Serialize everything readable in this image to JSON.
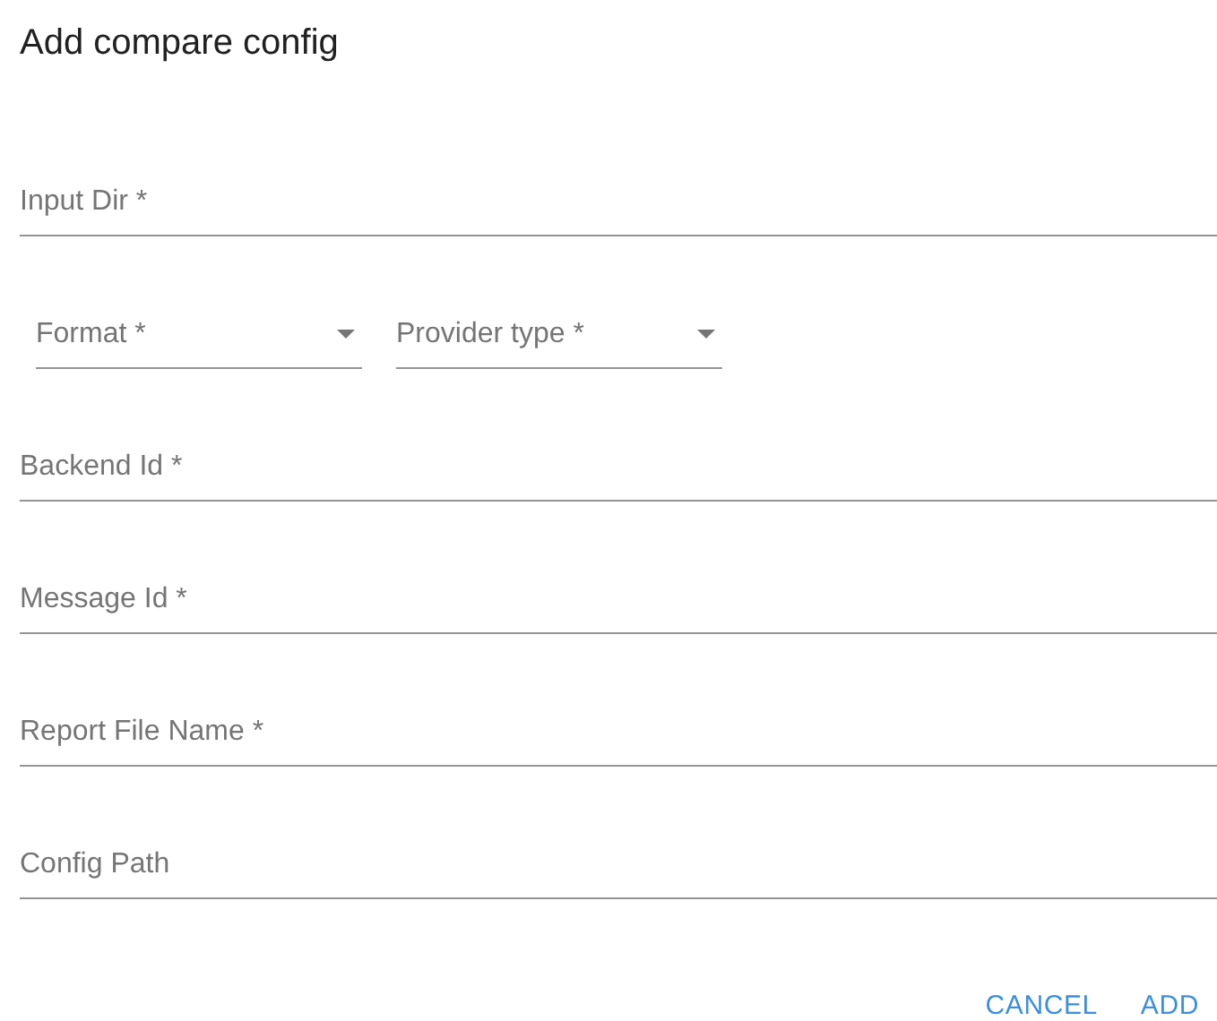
{
  "dialog": {
    "title": "Add compare config",
    "fields": [
      {
        "kind": "text",
        "placeholder": "Input Dir *"
      },
      {
        "kind": "select_row",
        "selects": [
          {
            "label": "Format *"
          },
          {
            "label": "Provider type *"
          }
        ]
      },
      {
        "kind": "text",
        "placeholder": "Backend Id *"
      },
      {
        "kind": "text",
        "placeholder": "Message Id *"
      },
      {
        "kind": "text",
        "placeholder": "Report File Name *"
      },
      {
        "kind": "text",
        "placeholder": "Config Path"
      }
    ],
    "buttons": [
      "CANCEL",
      "ADD"
    ]
  }
}
